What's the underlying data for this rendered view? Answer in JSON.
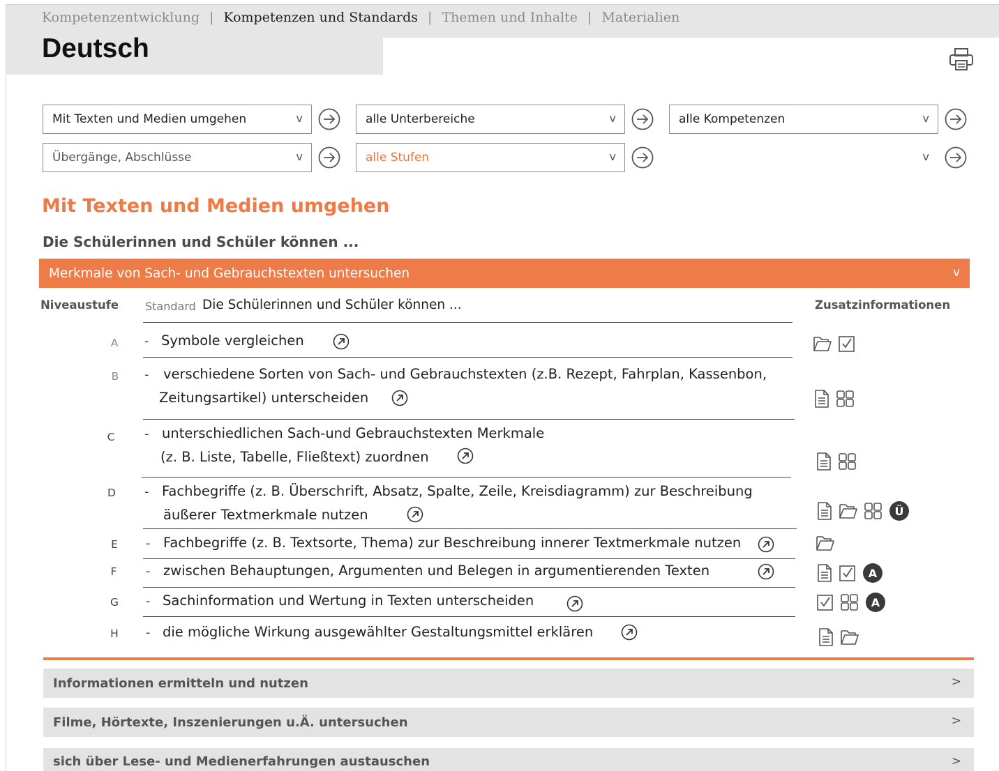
{
  "nav": {
    "items": [
      {
        "label": "Kompetenzentwicklung",
        "active": false
      },
      {
        "label": "Kompetenzen und Standards",
        "active": true
      },
      {
        "label": "Themen und Inhalte",
        "active": false
      },
      {
        "label": "Materialien",
        "active": false
      }
    ],
    "separator": "|"
  },
  "page_title": "Deutsch",
  "toolbar": {
    "print_icon": "printer-icon"
  },
  "filters": {
    "bereich": "Mit Texten und Medien umgehen",
    "unterbereich": "alle Unterbereiche",
    "kompetenzen": "alle Kompetenzen",
    "uebergaenge": "Übergänge, Abschlüsse",
    "stufen": "alle Stufen",
    "empty": "",
    "caret": "v",
    "go_icon": "arrow-right-circle-icon"
  },
  "section": {
    "title": "Mit Texten und Medien umgehen",
    "lead": "Die Schülerinnen und Schüler können ..."
  },
  "open_group": {
    "title": "Merkmale von Sach- und Gebrauchstexten untersuchen",
    "caret": "v"
  },
  "table": {
    "headers": {
      "niveau": "Niveaustufe",
      "standard_label": "Standard",
      "standard_text": "Die Schülerinnen und Schüler können ...",
      "zusatz": "Zusatzinformationen"
    },
    "dash": "-",
    "rows": [
      {
        "level": "A",
        "lines": [
          "Symbole vergleichen"
        ],
        "icons": [
          "folder-icon",
          "checkbox-icon"
        ]
      },
      {
        "level": "B",
        "lines": [
          "verschiedene Sorten von Sach- und Gebrauchstexten (z.B. Rezept, Fahrplan, Kassenbon,",
          "Zeitungsartikel) unterscheiden"
        ],
        "icons": [
          "document-icon",
          "grid-icon"
        ]
      },
      {
        "level": "C",
        "lines": [
          "unterschiedlichen Sach-und Gebrauchstexten Merkmale",
          "(z. B. Liste, Tabelle, Fließtext) zuordnen"
        ],
        "icons": [
          "document-icon",
          "grid-icon"
        ]
      },
      {
        "level": "D",
        "lines": [
          "Fachbegriffe (z. B. Überschrift, Absatz, Spalte, Zeile, Kreisdiagramm) zur Beschreibung",
          "äußerer Textmerkmale nutzen"
        ],
        "icons": [
          "document-icon",
          "folder-icon",
          "grid-icon",
          "badge-u-icon"
        ]
      },
      {
        "level": "E",
        "lines": [
          "Fachbegriffe (z. B. Textsorte, Thema) zur Beschreibung innerer Textmerkmale nutzen"
        ],
        "icons": [
          "folder-icon"
        ]
      },
      {
        "level": "F",
        "lines": [
          "zwischen Behauptungen, Argumenten und Belegen in argumentierenden Texten"
        ],
        "icons": [
          "document-icon",
          "checkbox-icon",
          "badge-a-icon"
        ]
      },
      {
        "level": "G",
        "lines": [
          "Sachinformation und Wertung in Texten unterscheiden"
        ],
        "icons": [
          "checkbox-icon",
          "grid-icon",
          "badge-a-icon"
        ]
      },
      {
        "level": "H",
        "lines": [
          "die mögliche Wirkung ausgewählter Gestaltungsmittel erklären"
        ],
        "icons": [
          "document-icon",
          "folder-icon"
        ]
      }
    ],
    "badge_u": "Ü",
    "badge_a": "A",
    "link_icon": "external-link-circle-icon"
  },
  "collapsed_groups": [
    {
      "title": "Informationen ermitteln und nutzen",
      "caret": ">"
    },
    {
      "title": "Filme, Hörtexte, Inszenierungen u.Ä. untersuchen",
      "caret": ">"
    },
    {
      "title": "sich über Lese- und Medienerfahrungen austauschen",
      "caret": ">"
    }
  ],
  "colors": {
    "accent": "#ee7c48",
    "header_gray": "#e6e6e6",
    "collapsed_gray": "#e3e3e3"
  }
}
